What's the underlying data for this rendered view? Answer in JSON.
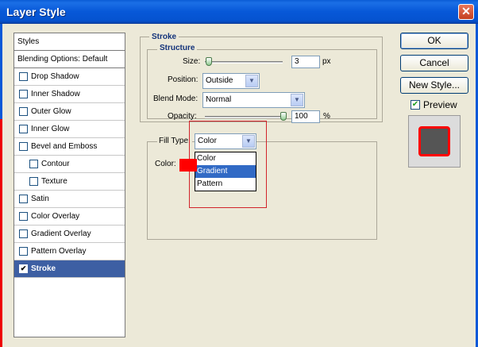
{
  "window": {
    "title": "Layer Style"
  },
  "styles_list": [
    {
      "label": "Styles",
      "checkbox": false,
      "header": true
    },
    {
      "label": "Blending Options: Default",
      "checkbox": false,
      "header": true
    },
    {
      "label": "Drop Shadow",
      "checkbox": true
    },
    {
      "label": "Inner Shadow",
      "checkbox": true
    },
    {
      "label": "Outer Glow",
      "checkbox": true
    },
    {
      "label": "Inner Glow",
      "checkbox": true
    },
    {
      "label": "Bevel and Emboss",
      "checkbox": true
    },
    {
      "label": "Contour",
      "checkbox": true,
      "indent": true
    },
    {
      "label": "Texture",
      "checkbox": true,
      "indent": true
    },
    {
      "label": "Satin",
      "checkbox": true
    },
    {
      "label": "Color Overlay",
      "checkbox": true
    },
    {
      "label": "Gradient Overlay",
      "checkbox": true
    },
    {
      "label": "Pattern Overlay",
      "checkbox": true
    },
    {
      "label": "Stroke",
      "checkbox": true,
      "checked": true,
      "selected": true
    }
  ],
  "stroke": {
    "group_label": "Stroke",
    "structure_label": "Structure",
    "size_label": "Size:",
    "size_value": "3",
    "size_unit": "px",
    "position_label": "Position:",
    "position_value": "Outside",
    "blend_mode_label": "Blend Mode:",
    "blend_mode_value": "Normal",
    "opacity_label": "Opacity:",
    "opacity_value": "100",
    "opacity_unit": "%",
    "fill_type_label": "Fill Type:",
    "fill_type_value": "Color",
    "fill_type_options": [
      "Color",
      "Gradient",
      "Pattern"
    ],
    "fill_type_highlighted": "Gradient",
    "color_label": "Color:",
    "stroke_color": "#ff0000"
  },
  "buttons": {
    "ok": "OK",
    "cancel": "Cancel",
    "new_style": "New Style..."
  },
  "preview": {
    "label": "Preview",
    "checked": true
  }
}
